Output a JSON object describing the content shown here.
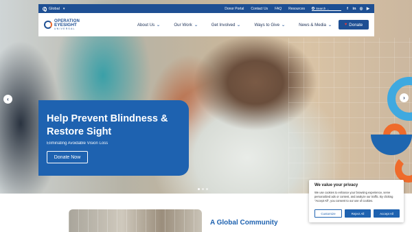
{
  "topbar": {
    "region_label": "Global",
    "links": [
      "Donor Portal",
      "Contact Us",
      "FAQ",
      "Resources"
    ],
    "search_placeholder": "Search ...",
    "social": [
      "f",
      "in",
      "◎",
      "▶"
    ]
  },
  "logo": {
    "line1": "OPERATION",
    "line2": "EYESIGHT",
    "line3": "UNIVERSAL"
  },
  "nav": {
    "items": [
      "About Us",
      "Our Work",
      "Get Involved",
      "Ways to Give",
      "News & Media"
    ],
    "donate_label": "Donate"
  },
  "hero": {
    "title": "Help Prevent Blindness & Restore Sight",
    "subtitle": "Eliminating Avoidable Vision Loss",
    "cta_label": "Donate Now",
    "slide_count": 3,
    "active_slide": 1
  },
  "section": {
    "title": "A Global Community"
  },
  "cookie": {
    "title": "We value your privacy",
    "text": "We use cookies to enhance your browsing experience, serve personalized ads or content, and analyze our traffic. By clicking \"Accept All\", you consent to our use of cookies.",
    "customize_label": "Customize",
    "reject_label": "Reject All",
    "accept_label": "Accept All"
  },
  "colors": {
    "brand_blue": "#1e4f93",
    "hero_card": "#1e62b0",
    "accent_orange": "#ef6b2b",
    "accent_light_blue": "#3fa9e0"
  }
}
